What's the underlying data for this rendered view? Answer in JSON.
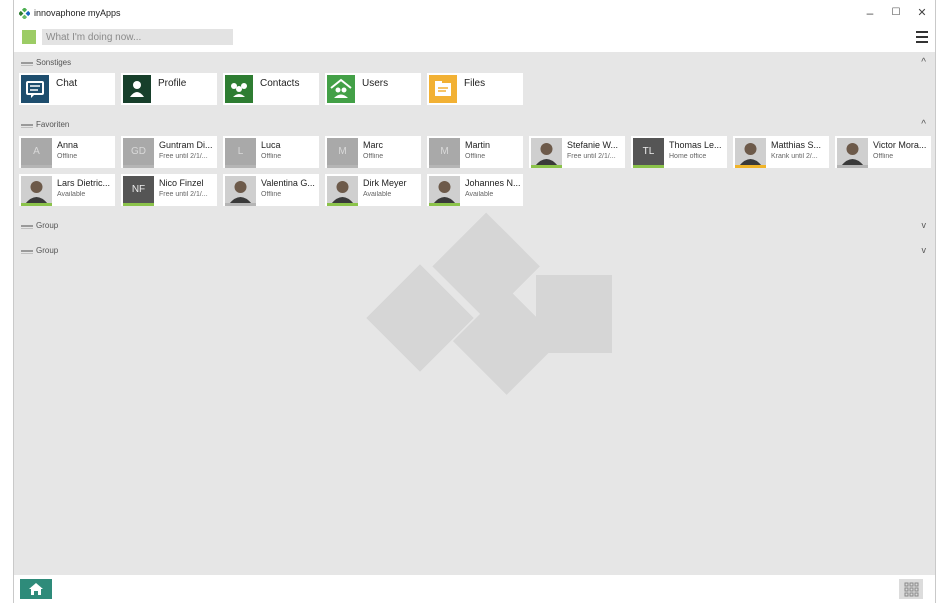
{
  "window": {
    "title": "innovaphone myApps",
    "minimize": "–",
    "maximize": "☐",
    "close": "✕"
  },
  "status": {
    "placeholder": "What I'm doing now...",
    "presence_color": "#9ccc65"
  },
  "sections": {
    "sonstiges": {
      "title": "Sonstiges",
      "chevron": "^"
    },
    "favoriten": {
      "title": "Favoriten",
      "chevron": "^"
    },
    "group1": {
      "title": "Group",
      "chevron": "v"
    },
    "group2": {
      "title": "Group",
      "chevron": "v"
    }
  },
  "apps": [
    {
      "label": "Chat",
      "icon": "chat-icon",
      "color": "#1e4e6e"
    },
    {
      "label": "Profile",
      "icon": "profile-icon",
      "color": "#173f2b"
    },
    {
      "label": "Contacts",
      "icon": "contacts-icon",
      "color": "#2e7d32"
    },
    {
      "label": "Users",
      "icon": "users-icon",
      "color": "#43a047"
    },
    {
      "label": "Files",
      "icon": "files-icon",
      "color": "#f2b134"
    }
  ],
  "favorites": [
    {
      "initials": "A",
      "name": "Anna",
      "status": "Offline",
      "bar": "#b5b5b5"
    },
    {
      "initials": "GD",
      "name": "Guntram Di...",
      "status": "Free until 2/1/...",
      "bar": "#b5b5b5"
    },
    {
      "initials": "L",
      "name": "Luca",
      "status": "Offline",
      "bar": "#b5b5b5"
    },
    {
      "initials": "M",
      "name": "Marc",
      "status": "Offline",
      "bar": "#b5b5b5"
    },
    {
      "initials": "M",
      "name": "Martin",
      "status": "Offline",
      "bar": "#b5b5b5"
    },
    {
      "initials": "",
      "name": "Stefanie W...",
      "status": "Free until 2/1/...",
      "bar": "#8bc34a",
      "photo": true
    },
    {
      "initials": "TL",
      "name": "Thomas Le...",
      "status": "Home office",
      "bar": "#8bc34a",
      "dark": true
    },
    {
      "initials": "",
      "name": "Matthias S...",
      "status": "Krank until 2/...",
      "bar": "#f0b429",
      "photo": true
    },
    {
      "initials": "",
      "name": "Victor Mora...",
      "status": "Offline",
      "bar": "#b5b5b5",
      "photo": true
    },
    {
      "initials": "",
      "name": "Lars Dietric...",
      "status": "Available",
      "bar": "#8bc34a",
      "photo": true
    },
    {
      "initials": "NF",
      "name": "Nico Finzel",
      "status": "Free until 2/1/...",
      "bar": "#8bc34a",
      "dark": true
    },
    {
      "initials": "",
      "name": "Valentina G...",
      "status": "Offline",
      "bar": "#b5b5b5",
      "photo": true
    },
    {
      "initials": "",
      "name": "Dirk Meyer",
      "status": "Available",
      "bar": "#8bc34a",
      "photo": true
    },
    {
      "initials": "",
      "name": "Johannes N...",
      "status": "Available",
      "bar": "#8bc34a",
      "photo": true
    }
  ],
  "bottom": {
    "home_icon": "home-icon",
    "grid_icon": "app-grid-icon"
  }
}
